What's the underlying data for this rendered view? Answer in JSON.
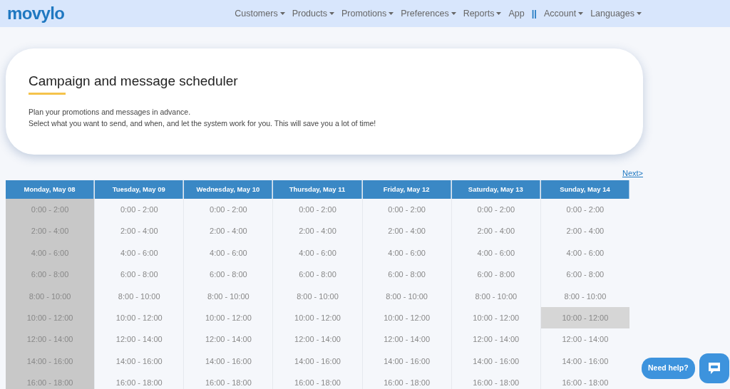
{
  "logo": "movylo",
  "nav": [
    {
      "kind": "menu",
      "label": "Customers",
      "dropdown": true
    },
    {
      "kind": "menu",
      "label": "Products",
      "dropdown": true
    },
    {
      "kind": "menu",
      "label": "Promotions",
      "dropdown": true
    },
    {
      "kind": "menu",
      "label": "Preferences",
      "dropdown": true
    },
    {
      "kind": "menu",
      "label": "Reports",
      "dropdown": true
    },
    {
      "kind": "menu",
      "label": "App",
      "dropdown": false
    },
    {
      "kind": "separator",
      "label": "||"
    },
    {
      "kind": "menu",
      "label": "Account",
      "dropdown": true
    },
    {
      "kind": "menu",
      "label": "Languages",
      "dropdown": true
    }
  ],
  "header": {
    "title": "Campaign and message scheduler",
    "lines": [
      "Plan your promotions and messages in advance.",
      "Select what you want to send, and when, and let the system work for you. This will save you a lot of time!"
    ]
  },
  "next_link": "Next>",
  "days": [
    {
      "label": "Monday, May 08",
      "disabled": true,
      "slots": [
        {
          "time": "0:00 - 2:00",
          "selected": false
        },
        {
          "time": "2:00 - 4:00",
          "selected": false
        },
        {
          "time": "4:00 - 6:00",
          "selected": false
        },
        {
          "time": "6:00 - 8:00",
          "selected": false
        },
        {
          "time": "8:00 - 10:00",
          "selected": false
        },
        {
          "time": "10:00 - 12:00",
          "selected": false
        },
        {
          "time": "12:00 - 14:00",
          "selected": false
        },
        {
          "time": "14:00 - 16:00",
          "selected": false
        },
        {
          "time": "16:00 - 18:00",
          "selected": false
        }
      ]
    },
    {
      "label": "Tuesday, May 09",
      "disabled": false,
      "slots": [
        {
          "time": "0:00 - 2:00",
          "selected": false
        },
        {
          "time": "2:00 - 4:00",
          "selected": false
        },
        {
          "time": "4:00 - 6:00",
          "selected": false
        },
        {
          "time": "6:00 - 8:00",
          "selected": false
        },
        {
          "time": "8:00 - 10:00",
          "selected": false
        },
        {
          "time": "10:00 - 12:00",
          "selected": false
        },
        {
          "time": "12:00 - 14:00",
          "selected": false
        },
        {
          "time": "14:00 - 16:00",
          "selected": false
        },
        {
          "time": "16:00 - 18:00",
          "selected": false
        }
      ]
    },
    {
      "label": "Wednesday, May 10",
      "disabled": false,
      "slots": [
        {
          "time": "0:00 - 2:00",
          "selected": false
        },
        {
          "time": "2:00 - 4:00",
          "selected": false
        },
        {
          "time": "4:00 - 6:00",
          "selected": false
        },
        {
          "time": "6:00 - 8:00",
          "selected": false
        },
        {
          "time": "8:00 - 10:00",
          "selected": false
        },
        {
          "time": "10:00 - 12:00",
          "selected": false
        },
        {
          "time": "12:00 - 14:00",
          "selected": false
        },
        {
          "time": "14:00 - 16:00",
          "selected": false
        },
        {
          "time": "16:00 - 18:00",
          "selected": false
        }
      ]
    },
    {
      "label": "Thursday, May 11",
      "disabled": false,
      "slots": [
        {
          "time": "0:00 - 2:00",
          "selected": false
        },
        {
          "time": "2:00 - 4:00",
          "selected": false
        },
        {
          "time": "4:00 - 6:00",
          "selected": false
        },
        {
          "time": "6:00 - 8:00",
          "selected": false
        },
        {
          "time": "8:00 - 10:00",
          "selected": false
        },
        {
          "time": "10:00 - 12:00",
          "selected": false
        },
        {
          "time": "12:00 - 14:00",
          "selected": false
        },
        {
          "time": "14:00 - 16:00",
          "selected": false
        },
        {
          "time": "16:00 - 18:00",
          "selected": false
        }
      ]
    },
    {
      "label": "Friday, May 12",
      "disabled": false,
      "slots": [
        {
          "time": "0:00 - 2:00",
          "selected": false
        },
        {
          "time": "2:00 - 4:00",
          "selected": false
        },
        {
          "time": "4:00 - 6:00",
          "selected": false
        },
        {
          "time": "6:00 - 8:00",
          "selected": false
        },
        {
          "time": "8:00 - 10:00",
          "selected": false
        },
        {
          "time": "10:00 - 12:00",
          "selected": false
        },
        {
          "time": "12:00 - 14:00",
          "selected": false
        },
        {
          "time": "14:00 - 16:00",
          "selected": false
        },
        {
          "time": "16:00 - 18:00",
          "selected": false
        }
      ]
    },
    {
      "label": "Saturday, May 13",
      "disabled": false,
      "slots": [
        {
          "time": "0:00 - 2:00",
          "selected": false
        },
        {
          "time": "2:00 - 4:00",
          "selected": false
        },
        {
          "time": "4:00 - 6:00",
          "selected": false
        },
        {
          "time": "6:00 - 8:00",
          "selected": false
        },
        {
          "time": "8:00 - 10:00",
          "selected": false
        },
        {
          "time": "10:00 - 12:00",
          "selected": false
        },
        {
          "time": "12:00 - 14:00",
          "selected": false
        },
        {
          "time": "14:00 - 16:00",
          "selected": false
        },
        {
          "time": "16:00 - 18:00",
          "selected": false
        }
      ]
    },
    {
      "label": "Sunday, May 14",
      "disabled": false,
      "slots": [
        {
          "time": "0:00 - 2:00",
          "selected": false
        },
        {
          "time": "2:00 - 4:00",
          "selected": false
        },
        {
          "time": "4:00 - 6:00",
          "selected": false
        },
        {
          "time": "6:00 - 8:00",
          "selected": false
        },
        {
          "time": "8:00 - 10:00",
          "selected": false
        },
        {
          "time": "10:00 - 12:00",
          "selected": true
        },
        {
          "time": "12:00 - 14:00",
          "selected": false
        },
        {
          "time": "14:00 - 16:00",
          "selected": false
        },
        {
          "time": "16:00 - 18:00",
          "selected": false
        }
      ]
    }
  ],
  "help": {
    "label": "Need help?"
  }
}
